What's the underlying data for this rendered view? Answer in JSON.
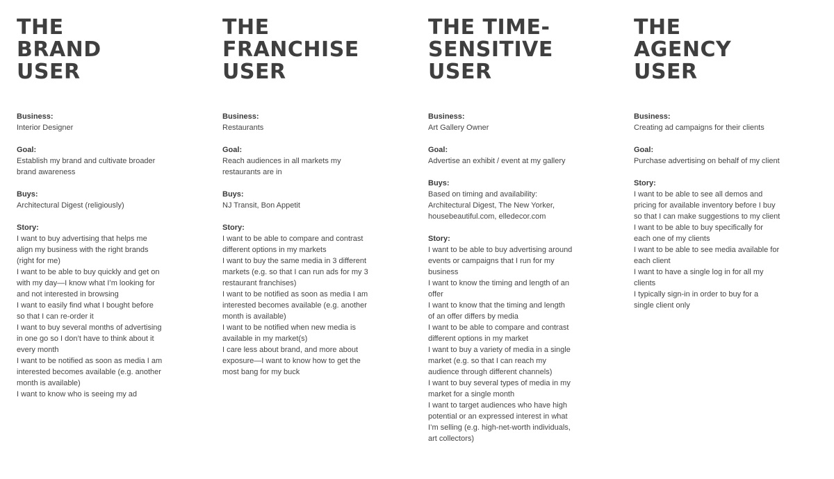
{
  "personas": [
    {
      "title_lines": [
        "THE",
        "BRAND",
        "USER"
      ],
      "sections": [
        {
          "label": "Business:",
          "lines": [
            "Interior Designer"
          ]
        },
        {
          "label": "Goal:",
          "lines": [
            "Establish my brand and cultivate broader",
            "brand awareness"
          ]
        },
        {
          "label": "Buys:",
          "lines": [
            "Architectural Digest (religiously)"
          ]
        },
        {
          "label": "Story:",
          "lines": [
            "I want to buy advertising that helps me",
            "align my business with the right brands",
            "(right for me)",
            "I want to be able to buy quickly and get on",
            "with my day—I know what I’m looking for",
            "and not interested in browsing",
            "I want to easily find what I bought before",
            "so that I can re-order it",
            "I want to buy several months of advertising",
            "in one go so I don’t have to think about it",
            "every month",
            "I want to be notified as soon as media I am",
            "interested becomes available (e.g. another",
            "month is available)",
            "I want to know who is seeing my ad"
          ]
        }
      ]
    },
    {
      "title_lines": [
        "THE",
        "FRANCHISE",
        "USER"
      ],
      "sections": [
        {
          "label": "Business:",
          "lines": [
            "Restaurants"
          ]
        },
        {
          "label": "Goal:",
          "lines": [
            "Reach audiences in all markets my",
            "restaurants are in"
          ]
        },
        {
          "label": "Buys:",
          "lines": [
            "NJ Transit, Bon Appetit"
          ]
        },
        {
          "label": "Story:",
          "lines": [
            "I want to be able to compare and contrast",
            "different options in my markets",
            "I want to buy the same media in 3 different",
            "markets (e.g. so that I can run ads for my 3",
            "restaurant franchises)",
            "I want to be notified as soon as media I am",
            "interested becomes available (e.g. another",
            "month is available)",
            "I want to be notified when new media is",
            "available in my market(s)",
            "I care less about brand, and more about",
            "exposure—I want to know how to get the",
            "most bang for my buck"
          ]
        }
      ]
    },
    {
      "title_lines": [
        "THE TIME-",
        "SENSITIVE",
        "USER"
      ],
      "sections": [
        {
          "label": "Business:",
          "lines": [
            "Art Gallery Owner"
          ]
        },
        {
          "label": "Goal:",
          "lines": [
            "Advertise an exhibit / event at my gallery"
          ]
        },
        {
          "label": "Buys:",
          "lines": [
            "Based on timing and availability:",
            "Architectural Digest, The New Yorker,",
            "housebeautiful.com, elledecor.com"
          ]
        },
        {
          "label": "Story:",
          "lines": [
            "I want to be able to buy advertising around",
            "events or campaigns that I run for my",
            "business",
            "I want to know the timing and length of an",
            "offer",
            "I want to know that the timing and length",
            "of an offer differs by media",
            "I want to be able to compare and contrast",
            "different options in my market",
            "I want to buy a variety of media in a single",
            "market (e.g. so that I can reach my",
            "audience through different channels)",
            "I want to buy several types of media in my",
            "market for a single month",
            "I want to target audiences who have high",
            "potential or an expressed interest in what",
            "I’m selling (e.g. high-net-worth individuals,",
            "art collectors)"
          ]
        }
      ]
    },
    {
      "title_lines": [
        "THE",
        "AGENCY",
        "USER"
      ],
      "sections": [
        {
          "label": "Business:",
          "lines": [
            "Creating ad campaigns for their clients"
          ]
        },
        {
          "label": "Goal:",
          "lines": [
            "Purchase advertising on behalf of my client"
          ]
        },
        {
          "label": "Story:",
          "lines": [
            "I want to be able to see all demos and",
            "pricing for available inventory before I buy",
            "so that I can make suggestions to my client",
            "I want to be able to buy specifically for",
            "each one of my clients",
            "I want to be able to see media available for",
            "each client",
            "I want to have a single log in for all my",
            "clients",
            "I typically sign-in in order to buy for a",
            "single client only"
          ]
        }
      ]
    }
  ]
}
